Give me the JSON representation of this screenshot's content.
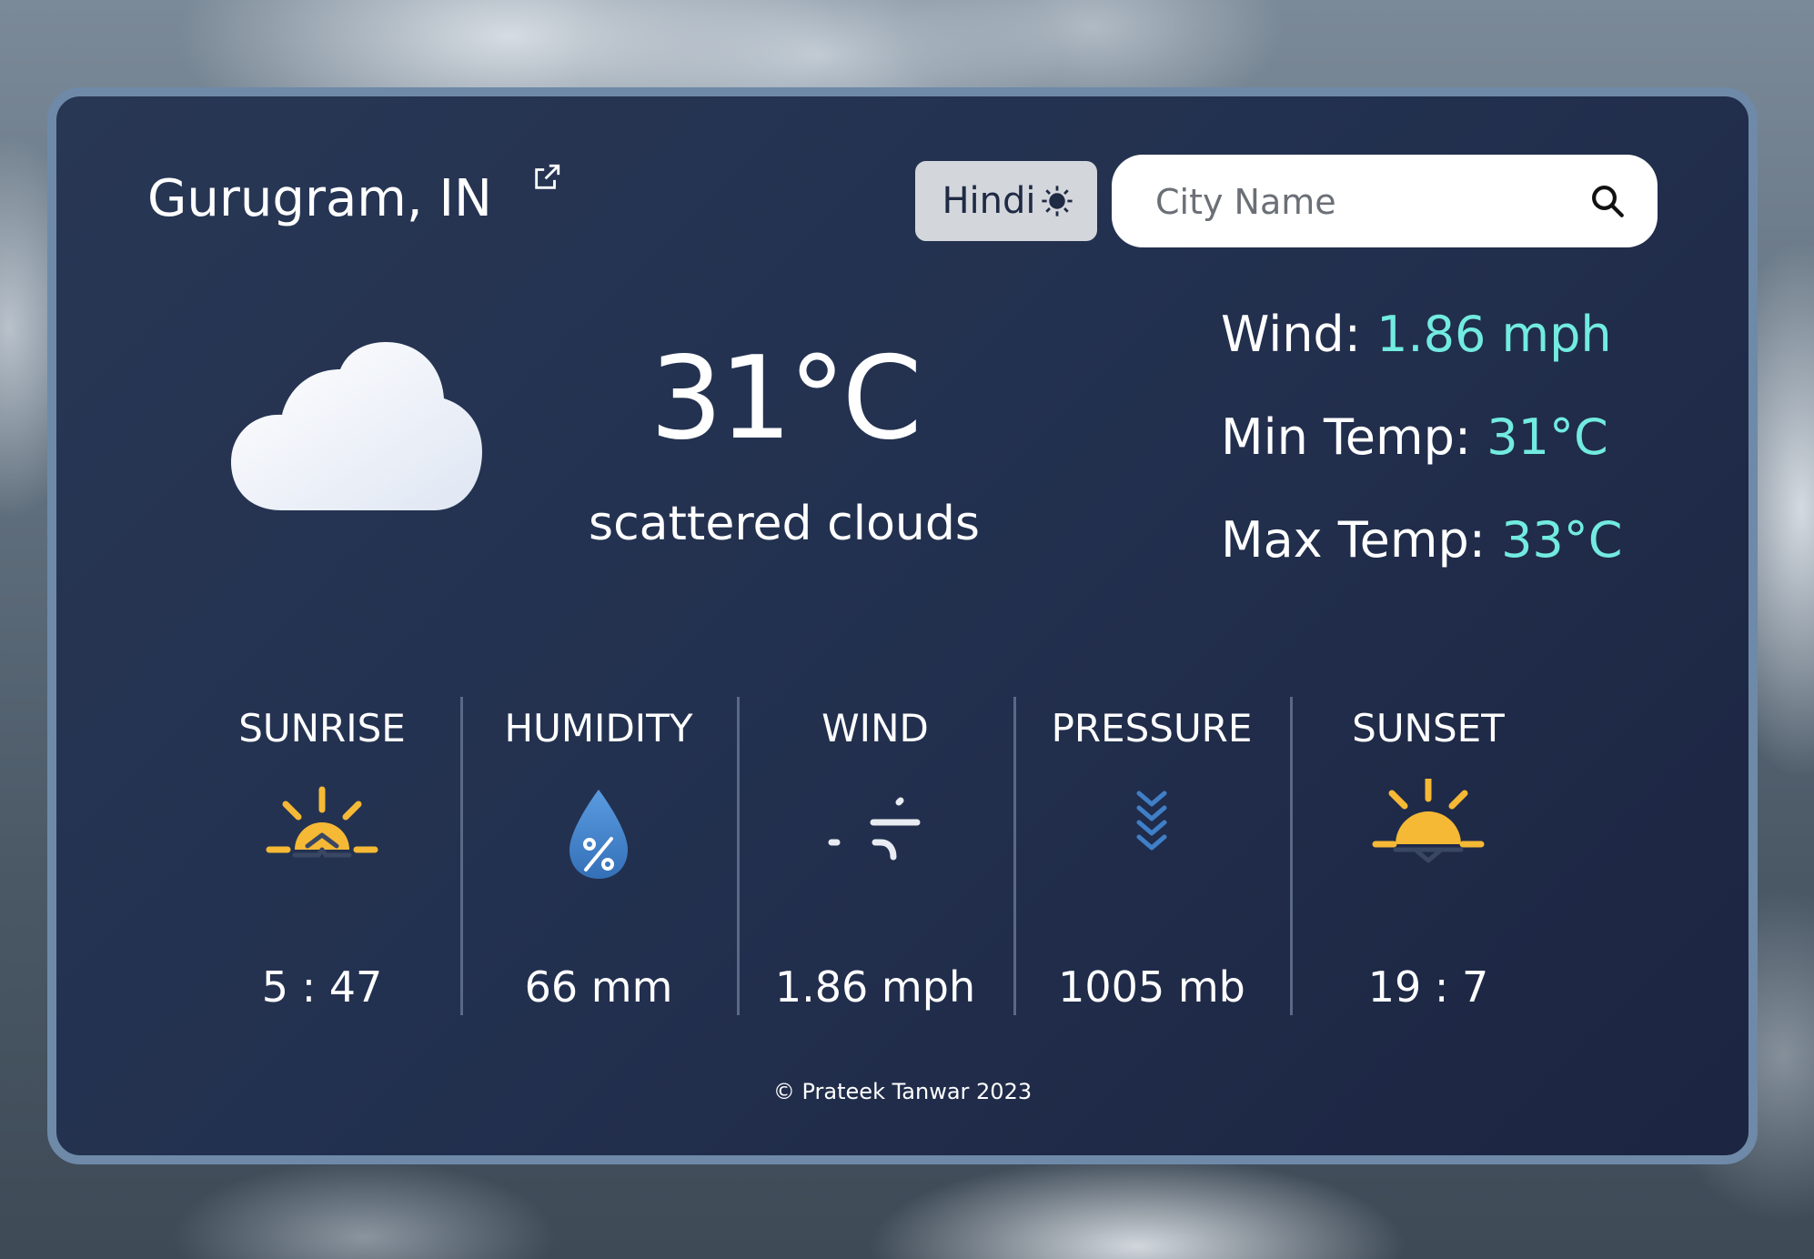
{
  "header": {
    "city": "Gurugram, IN",
    "language_button": "Hindi",
    "search_placeholder": "City Name"
  },
  "current": {
    "temperature": "31°C",
    "description": "scattered clouds",
    "icon": "cloud-icon"
  },
  "stats": {
    "wind_label": "Wind: ",
    "wind_value": "1.86 mph",
    "min_label": "Min Temp: ",
    "min_value": "31°C",
    "max_label": "Max Temp: ",
    "max_value": "33°C"
  },
  "metrics": [
    {
      "label": "SUNRISE",
      "value": "5 : 47",
      "icon": "sunrise-icon"
    },
    {
      "label": "HUMIDITY",
      "value": "66 mm",
      "icon": "humidity-drop-icon"
    },
    {
      "label": "WIND",
      "value": "1.86 mph",
      "icon": "wind-icon"
    },
    {
      "label": "PRESSURE",
      "value": "1005 mb",
      "icon": "pressure-icon"
    },
    {
      "label": "SUNSET",
      "value": "19 : 7",
      "icon": "sunset-icon"
    }
  ],
  "footer": {
    "copyright": "© Prateek Tanwar 2023"
  },
  "colors": {
    "accent": "#72ebe0",
    "card": "#233150",
    "border": "#6e8aa8",
    "sun": "#f5b935",
    "drop": "#3f7fc8"
  }
}
